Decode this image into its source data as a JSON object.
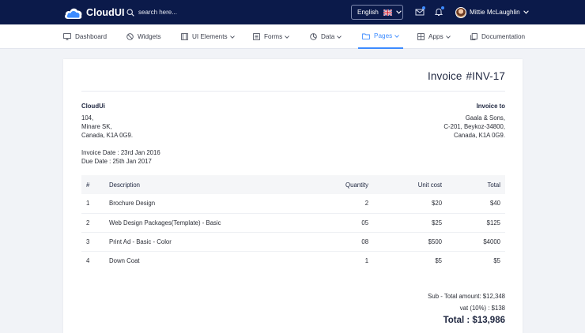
{
  "topbar": {
    "brand": "CloudUI",
    "search_placeholder": "search here...",
    "language": "English",
    "user_name": "Mittie McLaughlin"
  },
  "nav": {
    "items": [
      {
        "label": "Dashboard",
        "icon": "monitor-icon"
      },
      {
        "label": "Widgets",
        "icon": "no-entry-icon"
      },
      {
        "label": "UI Elements",
        "icon": "frame-icon"
      },
      {
        "label": "Forms",
        "icon": "list-icon"
      },
      {
        "label": "Data",
        "icon": "pie-icon"
      },
      {
        "label": "Pages",
        "icon": "folder-icon",
        "active": true
      },
      {
        "label": "Apps",
        "icon": "grid-icon"
      },
      {
        "label": "Documentation",
        "icon": "document-icon"
      }
    ]
  },
  "invoice": {
    "title_word": "Invoice",
    "number": "#INV-17",
    "from": {
      "name": "CloudUi",
      "lines": [
        "104,",
        "Minare SK,",
        "Canada, K1A 0G9."
      ]
    },
    "to": {
      "heading": "Invoice to",
      "lines": [
        "Gaala & Sons,",
        "C-201, Beykoz-34800,",
        "Canada, K1A 0G9."
      ]
    },
    "invoice_date": "Invoice Date : 23rd Jan 2016",
    "due_date": "Due Date : 25th Jan 2017",
    "table": {
      "headers": [
        "#",
        "Description",
        "Quantity",
        "Unit cost",
        "Total"
      ],
      "rows": [
        [
          "1",
          "Brochure Design",
          "2",
          "$20",
          "$40"
        ],
        [
          "2",
          "Web Design Packages(Template) - Basic",
          "05",
          "$25",
          "$125"
        ],
        [
          "3",
          "Print Ad - Basic - Color",
          "08",
          "$500",
          "$4000"
        ],
        [
          "4",
          "Down Coat",
          "1",
          "$5",
          "$5"
        ]
      ]
    },
    "subtotal": "Sub - Total amount: $12,348",
    "vat": "vat (10%) : $138",
    "total": "Total : $13,986"
  },
  "colors": {
    "topbar_bg": "#0b1a4a",
    "accent": "#3d8bff",
    "page_bg": "#f1f3f7"
  }
}
